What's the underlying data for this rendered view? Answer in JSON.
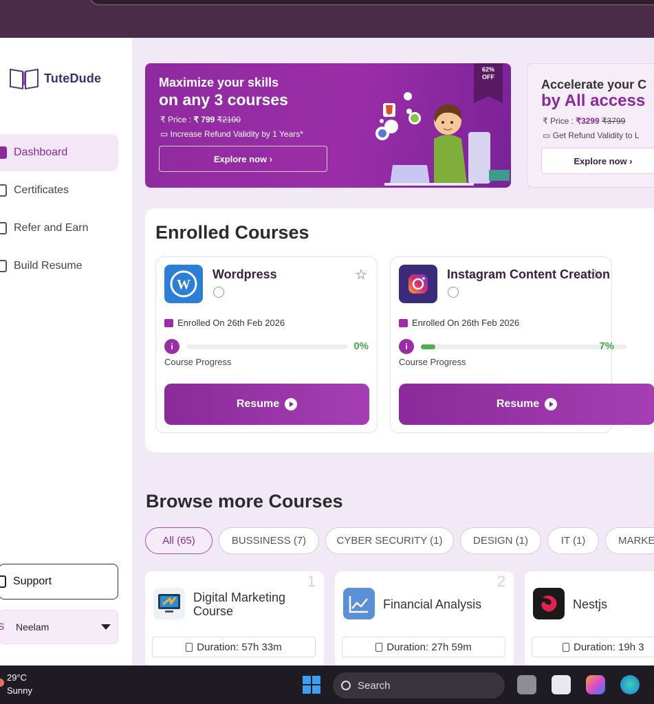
{
  "sidebar": {
    "logo": "TuteDude",
    "items": [
      {
        "label": "Dashboard"
      },
      {
        "label": "Certificates"
      },
      {
        "label": "Refer and Earn"
      },
      {
        "label": "Build Resume"
      }
    ],
    "support": "Support",
    "user_initial": "S",
    "user": "Neelam"
  },
  "banner1": {
    "line1": "Maximize your skills",
    "line2": "on any 3 courses",
    "price_label": "Price : ",
    "price": "₹ 799",
    "old_price": "₹2100",
    "refund": "Increase Refund Validity by 1 Years*",
    "cta": "Explore now",
    "ribbon_line1": "62%",
    "ribbon_line2": "OFF"
  },
  "banner2": {
    "line1": "Accelerate your C",
    "line2": "by All access",
    "price_label": "Price : ",
    "price": "₹3299",
    "old_price": "₹3799",
    "refund": "Get Refund Validity to L",
    "cta": "Explore now"
  },
  "enrolled": {
    "title": "Enrolled Courses",
    "progress_label": "Course Progress",
    "resume_label": "Resume",
    "courses": [
      {
        "name": "Wordpress",
        "enrolled": "Enrolled On 26th Feb 2026",
        "progress_text": "0%",
        "progress": 0
      },
      {
        "name": "Instagram Content Creation",
        "enrolled": "Enrolled On 26th Feb 2026",
        "progress_text": "7%",
        "progress": 0.07
      }
    ]
  },
  "browse": {
    "title": "Browse more Courses",
    "chips": [
      "All (65)",
      "BUSSINESS (7)",
      "CYBER SECURITY (1)",
      "DESIGN (1)",
      "IT (1)",
      "MARKE"
    ],
    "courses": [
      {
        "num": "1",
        "title_line1": "Digital Marketing",
        "title_line2": "Course",
        "duration": "Duration: 57h 33m"
      },
      {
        "num": "2",
        "title_line1": "Financial Analysis",
        "title_line2": "",
        "duration": "Duration: 27h 59m"
      },
      {
        "num": "",
        "title_line1": "Nestjs",
        "title_line2": "",
        "duration": "Duration: 19h 3"
      }
    ]
  },
  "taskbar": {
    "temp": "29°C",
    "condition": "Sunny",
    "search": "Search"
  },
  "colors": {
    "brand": "#8a2a9b",
    "progress": "#4caf50"
  }
}
